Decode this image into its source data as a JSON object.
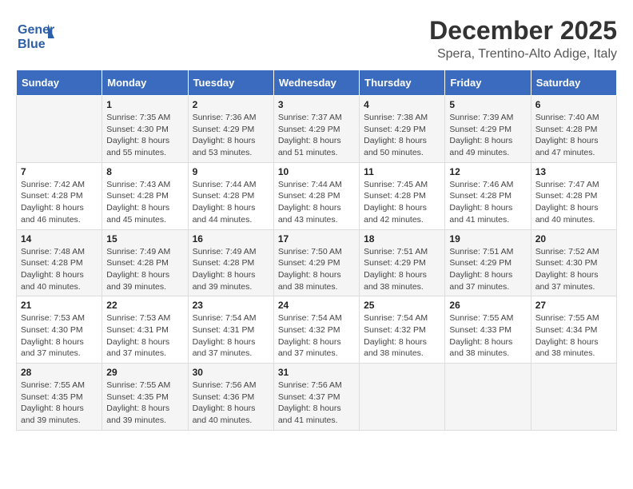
{
  "logo": {
    "line1": "General",
    "line2": "Blue"
  },
  "title": "December 2025",
  "subtitle": "Spera, Trentino-Alto Adige, Italy",
  "days_of_week": [
    "Sunday",
    "Monday",
    "Tuesday",
    "Wednesday",
    "Thursday",
    "Friday",
    "Saturday"
  ],
  "weeks": [
    [
      {
        "day": "",
        "sunrise": "",
        "sunset": "",
        "daylight": ""
      },
      {
        "day": "1",
        "sunrise": "Sunrise: 7:35 AM",
        "sunset": "Sunset: 4:30 PM",
        "daylight": "Daylight: 8 hours and 55 minutes."
      },
      {
        "day": "2",
        "sunrise": "Sunrise: 7:36 AM",
        "sunset": "Sunset: 4:29 PM",
        "daylight": "Daylight: 8 hours and 53 minutes."
      },
      {
        "day": "3",
        "sunrise": "Sunrise: 7:37 AM",
        "sunset": "Sunset: 4:29 PM",
        "daylight": "Daylight: 8 hours and 51 minutes."
      },
      {
        "day": "4",
        "sunrise": "Sunrise: 7:38 AM",
        "sunset": "Sunset: 4:29 PM",
        "daylight": "Daylight: 8 hours and 50 minutes."
      },
      {
        "day": "5",
        "sunrise": "Sunrise: 7:39 AM",
        "sunset": "Sunset: 4:29 PM",
        "daylight": "Daylight: 8 hours and 49 minutes."
      },
      {
        "day": "6",
        "sunrise": "Sunrise: 7:40 AM",
        "sunset": "Sunset: 4:28 PM",
        "daylight": "Daylight: 8 hours and 47 minutes."
      }
    ],
    [
      {
        "day": "7",
        "sunrise": "Sunrise: 7:42 AM",
        "sunset": "Sunset: 4:28 PM",
        "daylight": "Daylight: 8 hours and 46 minutes."
      },
      {
        "day": "8",
        "sunrise": "Sunrise: 7:43 AM",
        "sunset": "Sunset: 4:28 PM",
        "daylight": "Daylight: 8 hours and 45 minutes."
      },
      {
        "day": "9",
        "sunrise": "Sunrise: 7:44 AM",
        "sunset": "Sunset: 4:28 PM",
        "daylight": "Daylight: 8 hours and 44 minutes."
      },
      {
        "day": "10",
        "sunrise": "Sunrise: 7:44 AM",
        "sunset": "Sunset: 4:28 PM",
        "daylight": "Daylight: 8 hours and 43 minutes."
      },
      {
        "day": "11",
        "sunrise": "Sunrise: 7:45 AM",
        "sunset": "Sunset: 4:28 PM",
        "daylight": "Daylight: 8 hours and 42 minutes."
      },
      {
        "day": "12",
        "sunrise": "Sunrise: 7:46 AM",
        "sunset": "Sunset: 4:28 PM",
        "daylight": "Daylight: 8 hours and 41 minutes."
      },
      {
        "day": "13",
        "sunrise": "Sunrise: 7:47 AM",
        "sunset": "Sunset: 4:28 PM",
        "daylight": "Daylight: 8 hours and 40 minutes."
      }
    ],
    [
      {
        "day": "14",
        "sunrise": "Sunrise: 7:48 AM",
        "sunset": "Sunset: 4:28 PM",
        "daylight": "Daylight: 8 hours and 40 minutes."
      },
      {
        "day": "15",
        "sunrise": "Sunrise: 7:49 AM",
        "sunset": "Sunset: 4:28 PM",
        "daylight": "Daylight: 8 hours and 39 minutes."
      },
      {
        "day": "16",
        "sunrise": "Sunrise: 7:49 AM",
        "sunset": "Sunset: 4:28 PM",
        "daylight": "Daylight: 8 hours and 39 minutes."
      },
      {
        "day": "17",
        "sunrise": "Sunrise: 7:50 AM",
        "sunset": "Sunset: 4:29 PM",
        "daylight": "Daylight: 8 hours and 38 minutes."
      },
      {
        "day": "18",
        "sunrise": "Sunrise: 7:51 AM",
        "sunset": "Sunset: 4:29 PM",
        "daylight": "Daylight: 8 hours and 38 minutes."
      },
      {
        "day": "19",
        "sunrise": "Sunrise: 7:51 AM",
        "sunset": "Sunset: 4:29 PM",
        "daylight": "Daylight: 8 hours and 37 minutes."
      },
      {
        "day": "20",
        "sunrise": "Sunrise: 7:52 AM",
        "sunset": "Sunset: 4:30 PM",
        "daylight": "Daylight: 8 hours and 37 minutes."
      }
    ],
    [
      {
        "day": "21",
        "sunrise": "Sunrise: 7:53 AM",
        "sunset": "Sunset: 4:30 PM",
        "daylight": "Daylight: 8 hours and 37 minutes."
      },
      {
        "day": "22",
        "sunrise": "Sunrise: 7:53 AM",
        "sunset": "Sunset: 4:31 PM",
        "daylight": "Daylight: 8 hours and 37 minutes."
      },
      {
        "day": "23",
        "sunrise": "Sunrise: 7:54 AM",
        "sunset": "Sunset: 4:31 PM",
        "daylight": "Daylight: 8 hours and 37 minutes."
      },
      {
        "day": "24",
        "sunrise": "Sunrise: 7:54 AM",
        "sunset": "Sunset: 4:32 PM",
        "daylight": "Daylight: 8 hours and 37 minutes."
      },
      {
        "day": "25",
        "sunrise": "Sunrise: 7:54 AM",
        "sunset": "Sunset: 4:32 PM",
        "daylight": "Daylight: 8 hours and 38 minutes."
      },
      {
        "day": "26",
        "sunrise": "Sunrise: 7:55 AM",
        "sunset": "Sunset: 4:33 PM",
        "daylight": "Daylight: 8 hours and 38 minutes."
      },
      {
        "day": "27",
        "sunrise": "Sunrise: 7:55 AM",
        "sunset": "Sunset: 4:34 PM",
        "daylight": "Daylight: 8 hours and 38 minutes."
      }
    ],
    [
      {
        "day": "28",
        "sunrise": "Sunrise: 7:55 AM",
        "sunset": "Sunset: 4:35 PM",
        "daylight": "Daylight: 8 hours and 39 minutes."
      },
      {
        "day": "29",
        "sunrise": "Sunrise: 7:55 AM",
        "sunset": "Sunset: 4:35 PM",
        "daylight": "Daylight: 8 hours and 39 minutes."
      },
      {
        "day": "30",
        "sunrise": "Sunrise: 7:56 AM",
        "sunset": "Sunset: 4:36 PM",
        "daylight": "Daylight: 8 hours and 40 minutes."
      },
      {
        "day": "31",
        "sunrise": "Sunrise: 7:56 AM",
        "sunset": "Sunset: 4:37 PM",
        "daylight": "Daylight: 8 hours and 41 minutes."
      },
      {
        "day": "",
        "sunrise": "",
        "sunset": "",
        "daylight": ""
      },
      {
        "day": "",
        "sunrise": "",
        "sunset": "",
        "daylight": ""
      },
      {
        "day": "",
        "sunrise": "",
        "sunset": "",
        "daylight": ""
      }
    ]
  ]
}
